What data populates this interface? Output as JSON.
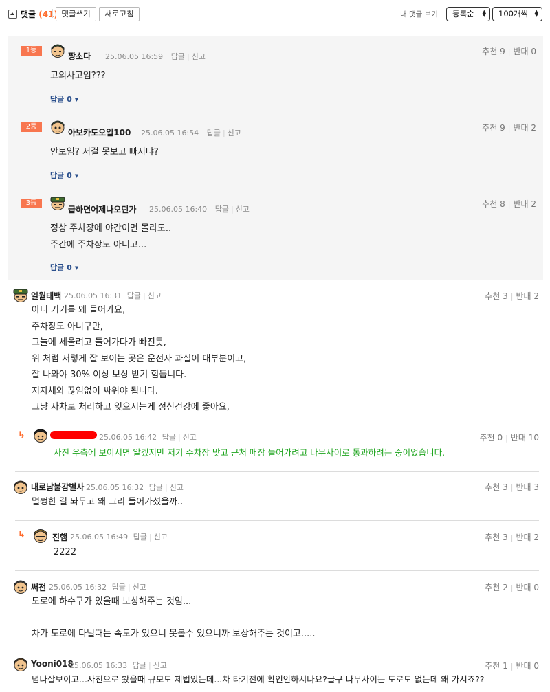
{
  "toolbar": {
    "title": "댓글",
    "count": "(41)",
    "write_label": "댓글쓰기",
    "refresh_label": "새로고침",
    "my_comments_label": "내 댓글 보기",
    "sort_selected": "등록순",
    "page_size_selected": "100개씩"
  },
  "labels": {
    "reply": "답글",
    "report": "신고",
    "recommend": "추천",
    "oppose": "반대"
  },
  "best_comments": [
    {
      "rank": "1등",
      "nickname": "짱소다",
      "datetime": "25.06.05 16:59",
      "lines": [
        "고의사고임???"
      ],
      "reply_toggle": "답글 0",
      "recommend": "9",
      "oppose": "0"
    },
    {
      "rank": "2등",
      "nickname": "아보카도오일100",
      "datetime": "25.06.05 16:54",
      "lines": [
        "안보임? 저걸 못보고 빠지냐?"
      ],
      "reply_toggle": "답글 0",
      "recommend": "9",
      "oppose": "2"
    },
    {
      "rank": "3등",
      "nickname": "급하면어제나오던가",
      "datetime": "25.06.05 16:40",
      "lines": [
        "정상 주차장에 야간이면 몰라도..",
        "주간에 주차장도 아니고..."
      ],
      "reply_toggle": "답글 0",
      "recommend": "8",
      "oppose": "2"
    }
  ],
  "comments": [
    {
      "nickname": "일월태백",
      "datetime": "25.06.05 16:31",
      "lines": [
        "아니 거기를 왜 들어가요,",
        "주차장도 아니구만,",
        "그늘에 세울려고 들어가다가 빠진듯,",
        "위 처럼 저렇게 잘 보이는 곳은 운전자 과실이 대부분이고,",
        "잘 나와야 30% 이상 보상 받기 힘듭니다.",
        "지자체와 끊임없이 싸워야 됩니다.",
        "그냥 자차로 처리하고 잊으시는게 정신건강에 좋아요,"
      ],
      "recommend": "3",
      "oppose": "2"
    },
    {
      "nickname": "",
      "datetime": "25.06.05 16:42",
      "lines": [
        "사진 우측에 보이시면 알겠지만 저기 주차장 맞고 근처 매장 들어가려고 나무사이로 통과하려는 중이었습니다."
      ],
      "recommend": "0",
      "oppose": "10"
    },
    {
      "nickname": "내로남불감별사",
      "datetime": "25.06.05 16:32",
      "lines": [
        "멀쩡한 길 놔두고 왜 그리 들어가셨을까.."
      ],
      "recommend": "3",
      "oppose": "3"
    },
    {
      "nickname": "진햄",
      "datetime": "25.06.05 16:49",
      "lines": [
        "2222"
      ],
      "recommend": "3",
      "oppose": "2"
    },
    {
      "nickname": "써전",
      "datetime": "25.06.05 16:32",
      "lines": [
        "도로에 하수구가 있을때 보상해주는 것임...",
        "차가 도로에 다닐때는 속도가 있으니 못볼수 있으니까 보상해주는 것이고....."
      ],
      "recommend": "2",
      "oppose": "0"
    },
    {
      "nickname": "Yooni018",
      "datetime": "25.06.05 16:33",
      "lines": [
        "넘나잘보이고...사진으로 봤을때 규모도 제법있는데...차 타기전에 확인안하시나요?글구 나무사이는 도로도 없는데 왜 가시죠??"
      ],
      "recommend": "1",
      "oppose": "0"
    }
  ]
}
